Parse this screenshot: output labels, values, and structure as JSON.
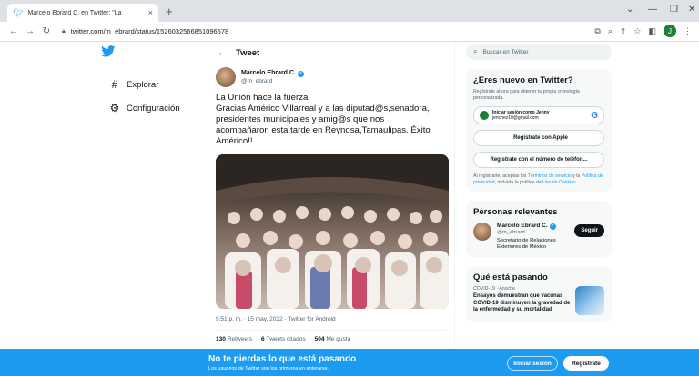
{
  "browser": {
    "tab_title": "Marcelo Ebrard C. en Twitter: \"La",
    "tab_close": "×",
    "new_tab": "+",
    "url": "twitter.com/m_ebrard/status/1526032566851096578",
    "profile_initial": "J"
  },
  "nav": {
    "items": [
      {
        "label": "Explorar",
        "icon": "#"
      },
      {
        "label": "Configuración",
        "icon": "⚙"
      }
    ]
  },
  "tweet": {
    "header": "Tweet",
    "author_name": "Marcelo Ebrard C.",
    "author_handle": "@m_ebrard",
    "text_lines": [
      "La Unión hace la fuerza",
      "Gracias Américo Villarreal y a las  diputad@s,senadora,",
      "presidentes municipales y amig@s que nos",
      "acompañaron esta tarde en Reynosa,Tamaulipas. Éxito",
      "Américo!!"
    ],
    "timestamp": "9:51 p. m. · 15 may. 2022 · Twitter for Android",
    "retweets": "130",
    "retweets_label": "Retweets",
    "quotes": "6",
    "quotes_label": "Tweets citados",
    "likes": "504",
    "likes_label": "Me gusta"
  },
  "sidebar": {
    "search_placeholder": "Buscar en Twitter",
    "new_title": "¿Eres nuevo en Twitter?",
    "new_subtitle": "Regístrate ahora para obtener tu propia cronología personalizada.",
    "google_title": "Iniciar sesión como Jenny",
    "google_email": "jenchez10@gmail.com",
    "apple_label": "Regístrate con Apple",
    "phone_label": "Registrate con el número de teléfon...",
    "terms_prefix": "Al registrarte, aceptas los ",
    "terms_link": "Términos de servicio",
    "terms_mid": " y la ",
    "privacy_link": "Política de privacidad",
    "terms_mid2": ", incluida la política de ",
    "cookies_link": "Uso de Cookies",
    "terms_end": ".",
    "relevant_title": "Personas relevantes",
    "person_name": "Marcelo Ebrard C.",
    "person_handle": "@m_ebrard",
    "person_bio": "Secretario de Relaciones Exteriores de México",
    "follow_label": "Seguir",
    "trends_title": "Qué está pasando",
    "trend_category": "COVID-19 · Anoche",
    "trend_headline": "Ensayos demuestran que vacunas COVID-19 disminuyen la gravedad de la enfermedad y su mortalidad"
  },
  "banner": {
    "title": "No te pierdas lo que está pasando",
    "subtitle": "Los usuarios de Twitter son los primeros en enterarse.",
    "login_label": "Iniciar sesión",
    "register_label": "Regístrate"
  },
  "colors": {
    "accent": "#1d9bf0",
    "text": "#0f1419",
    "muted": "#536471"
  }
}
